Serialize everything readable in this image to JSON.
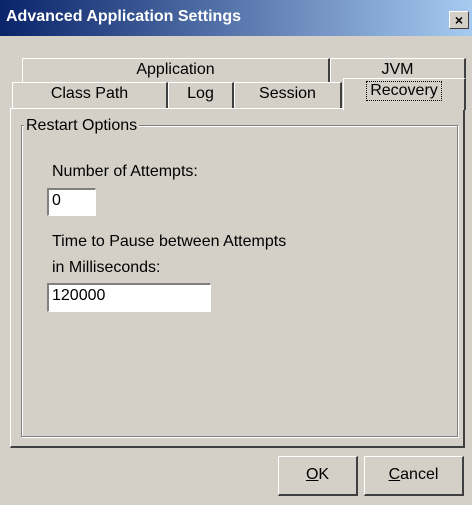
{
  "window": {
    "title": "Advanced Application Settings",
    "close_label": "×"
  },
  "tabs": {
    "row_back": [
      {
        "label": "Application"
      },
      {
        "label": "JVM"
      }
    ],
    "row_front": [
      {
        "label": "Class Path"
      },
      {
        "label": "Log"
      },
      {
        "label": "Session"
      },
      {
        "label": "Recovery",
        "active": true
      }
    ]
  },
  "restart_options": {
    "group_label": "Restart Options",
    "attempts_label": "Number of Attempts:",
    "attempts_value": "0",
    "pause_label_line1": "Time to Pause between Attempts",
    "pause_label_line2": "in Milliseconds:",
    "pause_value": "120000"
  },
  "buttons": {
    "ok_mnemonic": "O",
    "ok_rest": "K",
    "cancel_mnemonic": "C",
    "cancel_rest": "ancel"
  }
}
